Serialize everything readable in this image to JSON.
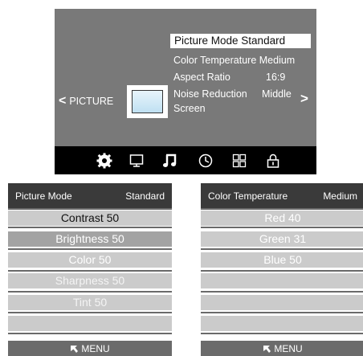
{
  "picture_menu": {
    "nav_left_label": "PICTURE",
    "nav_left_arrow": "<",
    "nav_right_arrow": ">",
    "items": [
      {
        "label": "Picture Mode",
        "value": "Standard"
      },
      {
        "label": "Color Temperature",
        "value": "Medium"
      },
      {
        "label": "Aspect Ratio",
        "value": "16:9"
      },
      {
        "label": "Noise Reduction",
        "value": "Middle"
      },
      {
        "label": "Screen",
        "value": ""
      }
    ],
    "selected_index": 0
  },
  "icon_bar": [
    {
      "name": "picture-gear-icon",
      "active": true
    },
    {
      "name": "monitor-icon",
      "active": false
    },
    {
      "name": "music-note-icon",
      "active": false
    },
    {
      "name": "clock-icon",
      "active": false
    },
    {
      "name": "grid-icon",
      "active": false
    },
    {
      "name": "lock-icon",
      "active": false
    }
  ],
  "picture_mode_panel": {
    "header_label": "Picture Mode",
    "header_value": "Standard",
    "rows": [
      "Contrast 50",
      "Brightness 50",
      "Color 50",
      "Sharpness 50",
      "Tint 50",
      "",
      ""
    ],
    "footer_label": "MENU"
  },
  "color_temperature_panel": {
    "header_label": "Color Temperature",
    "header_value": "Medium",
    "rows": [
      "Red 40",
      "Green 31",
      "Blue 50",
      "",
      "",
      "",
      ""
    ],
    "footer_label": "MENU"
  },
  "colors": {
    "menu_bg": "#797979",
    "icon_bar_bg": "#000000",
    "panel_header_bg": "#3a3a3a",
    "row_light": "#cbcbcb",
    "row_dark": "#a3a3a3",
    "footer_bg": "#6b6b6b"
  }
}
